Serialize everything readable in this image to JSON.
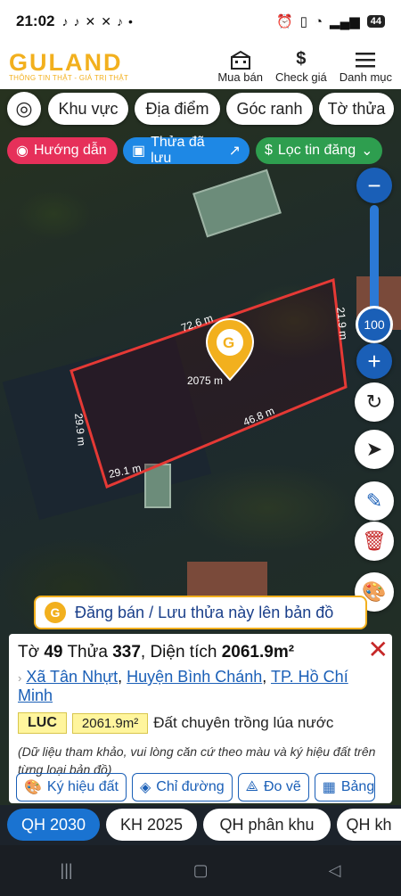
{
  "status": {
    "time": "21:02",
    "battery": "44"
  },
  "header": {
    "logo": "GULAND",
    "tagline": "THÔNG TIN THẬT - GIÁ TRỊ THẬT",
    "nav": [
      {
        "label": "Mua bán",
        "icon": "building-icon"
      },
      {
        "label": "Check giá",
        "icon": "dollar-icon"
      },
      {
        "label": "Danh mục",
        "icon": "menu-icon"
      }
    ]
  },
  "filters": [
    "Khu vực",
    "Địa điểm",
    "Góc ranh",
    "Tờ thửa"
  ],
  "subfilters": {
    "guide": "Hướng dẫn",
    "saved": "Thửa đã lưu",
    "listing": "Lọc tin đăng"
  },
  "map": {
    "edges": {
      "top": "72.6 m",
      "right": "21.9 m",
      "bottom": "46.8 m",
      "bottom_left": "29.1 m",
      "left": "29.9 m"
    },
    "area_label": "2075 m",
    "zoom": "100"
  },
  "banner": {
    "text": "Đăng bán / Lưu thửa này lên bản đồ"
  },
  "parcel": {
    "to_label": "Tờ",
    "to": "49",
    "thua_label": "Thửa",
    "thua": "337",
    "area_label": "Diện tích",
    "area": "2061.9m²",
    "ward": "Xã Tân Nhựt",
    "district": "Huyện Bình Chánh",
    "city": "TP. Hồ Chí Minh",
    "land_code": "LUC",
    "land_area": "2061.9m²",
    "land_desc": "Đất chuyên trồng lúa nước",
    "note": "(Dữ liệu tham khảo, vui lòng căn cứ theo màu và ký hiệu đất trên từng loại bản đồ)"
  },
  "actions": [
    "Ký hiệu đất",
    "Chỉ đường",
    "Đo vẽ",
    "Bảng"
  ],
  "plan_tabs": [
    "QH 2030",
    "KH 2025",
    "QH phân khu",
    "QH kh"
  ],
  "colors": {
    "brand": "#f2b01e",
    "accent": "#1a73d1",
    "guide": "#e6305a",
    "saved": "#1e88e5",
    "listing": "#2e9e4f",
    "parcel_outline": "#e53935"
  }
}
